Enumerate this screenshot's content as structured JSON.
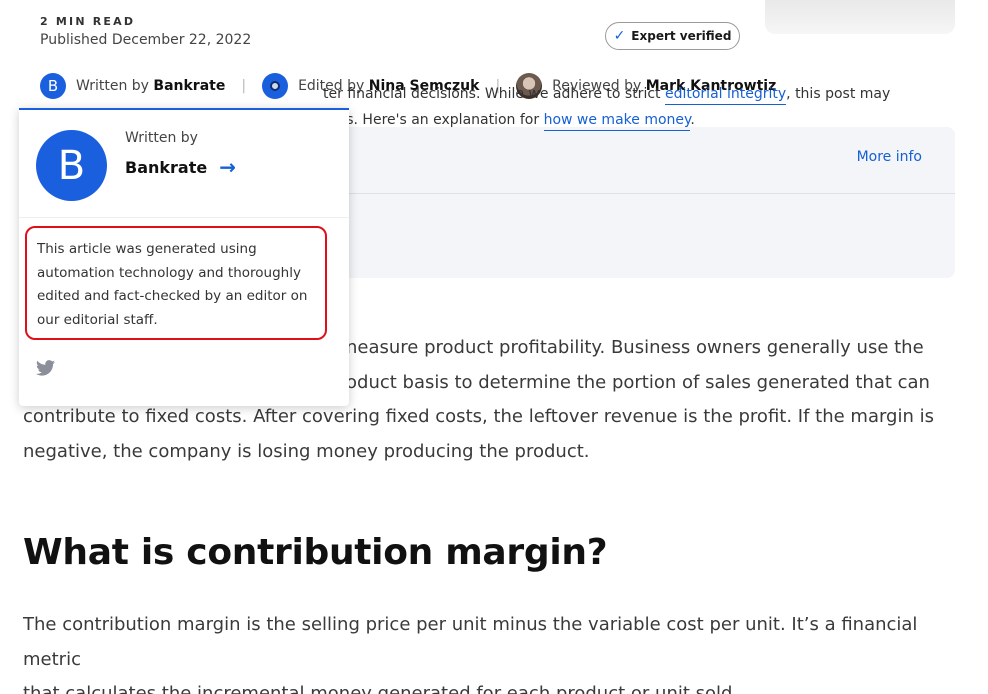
{
  "meta": {
    "read_time": "2 MIN READ",
    "published": "Published December 22, 2022",
    "expert_badge": "Expert verified"
  },
  "byline": {
    "author_avatar_letter": "B",
    "written_prefix": "Written by",
    "author": "Bankrate",
    "edited_prefix": "Edited by",
    "editor": "Nina Semczuk",
    "reviewed_prefix": "Reviewed by",
    "reviewer": "Mark Kantrowtiz",
    "separator": "|"
  },
  "info_box": {
    "more_info": "More info",
    "line1_text": "ter financial decisions. While we adhere to strict",
    "line1_link": "editorial integrity",
    "line1_tail": ", this post may",
    "line2_text": "ners. Here's an explanation for",
    "line2_link": "how we make money",
    "line2_tail": "."
  },
  "popover": {
    "avatar_letter": "B",
    "written_by": "Written by",
    "name": "Bankrate",
    "arrow": "→",
    "note": "This article was generated using automation technology and thoroughly edited and fact-checked by an editor on our editorial staff.",
    "icons": [
      "twitter-icon"
    ]
  },
  "article": {
    "para1": "neasure product profitability. Business owners generally use the",
    "para1_l2": "oduct basis to determine the portion of sales generated that can",
    "para1_l3": "contribute to fixed costs. After covering fixed costs, the leftover revenue is the profit. If the margin is",
    "para1_l4": "negative, the company is losing money producing the product.",
    "heading": "What is contribution margin?",
    "para2_l1": "The contribution margin is the selling price per unit minus the variable cost per unit. It’s a financial metric",
    "para2_l2": "that calculates the incremental money generated for each product or unit sold."
  },
  "colors": {
    "brand_blue": "#1a5fde",
    "link_blue": "#1560d4",
    "highlight_red": "#e0101a"
  }
}
